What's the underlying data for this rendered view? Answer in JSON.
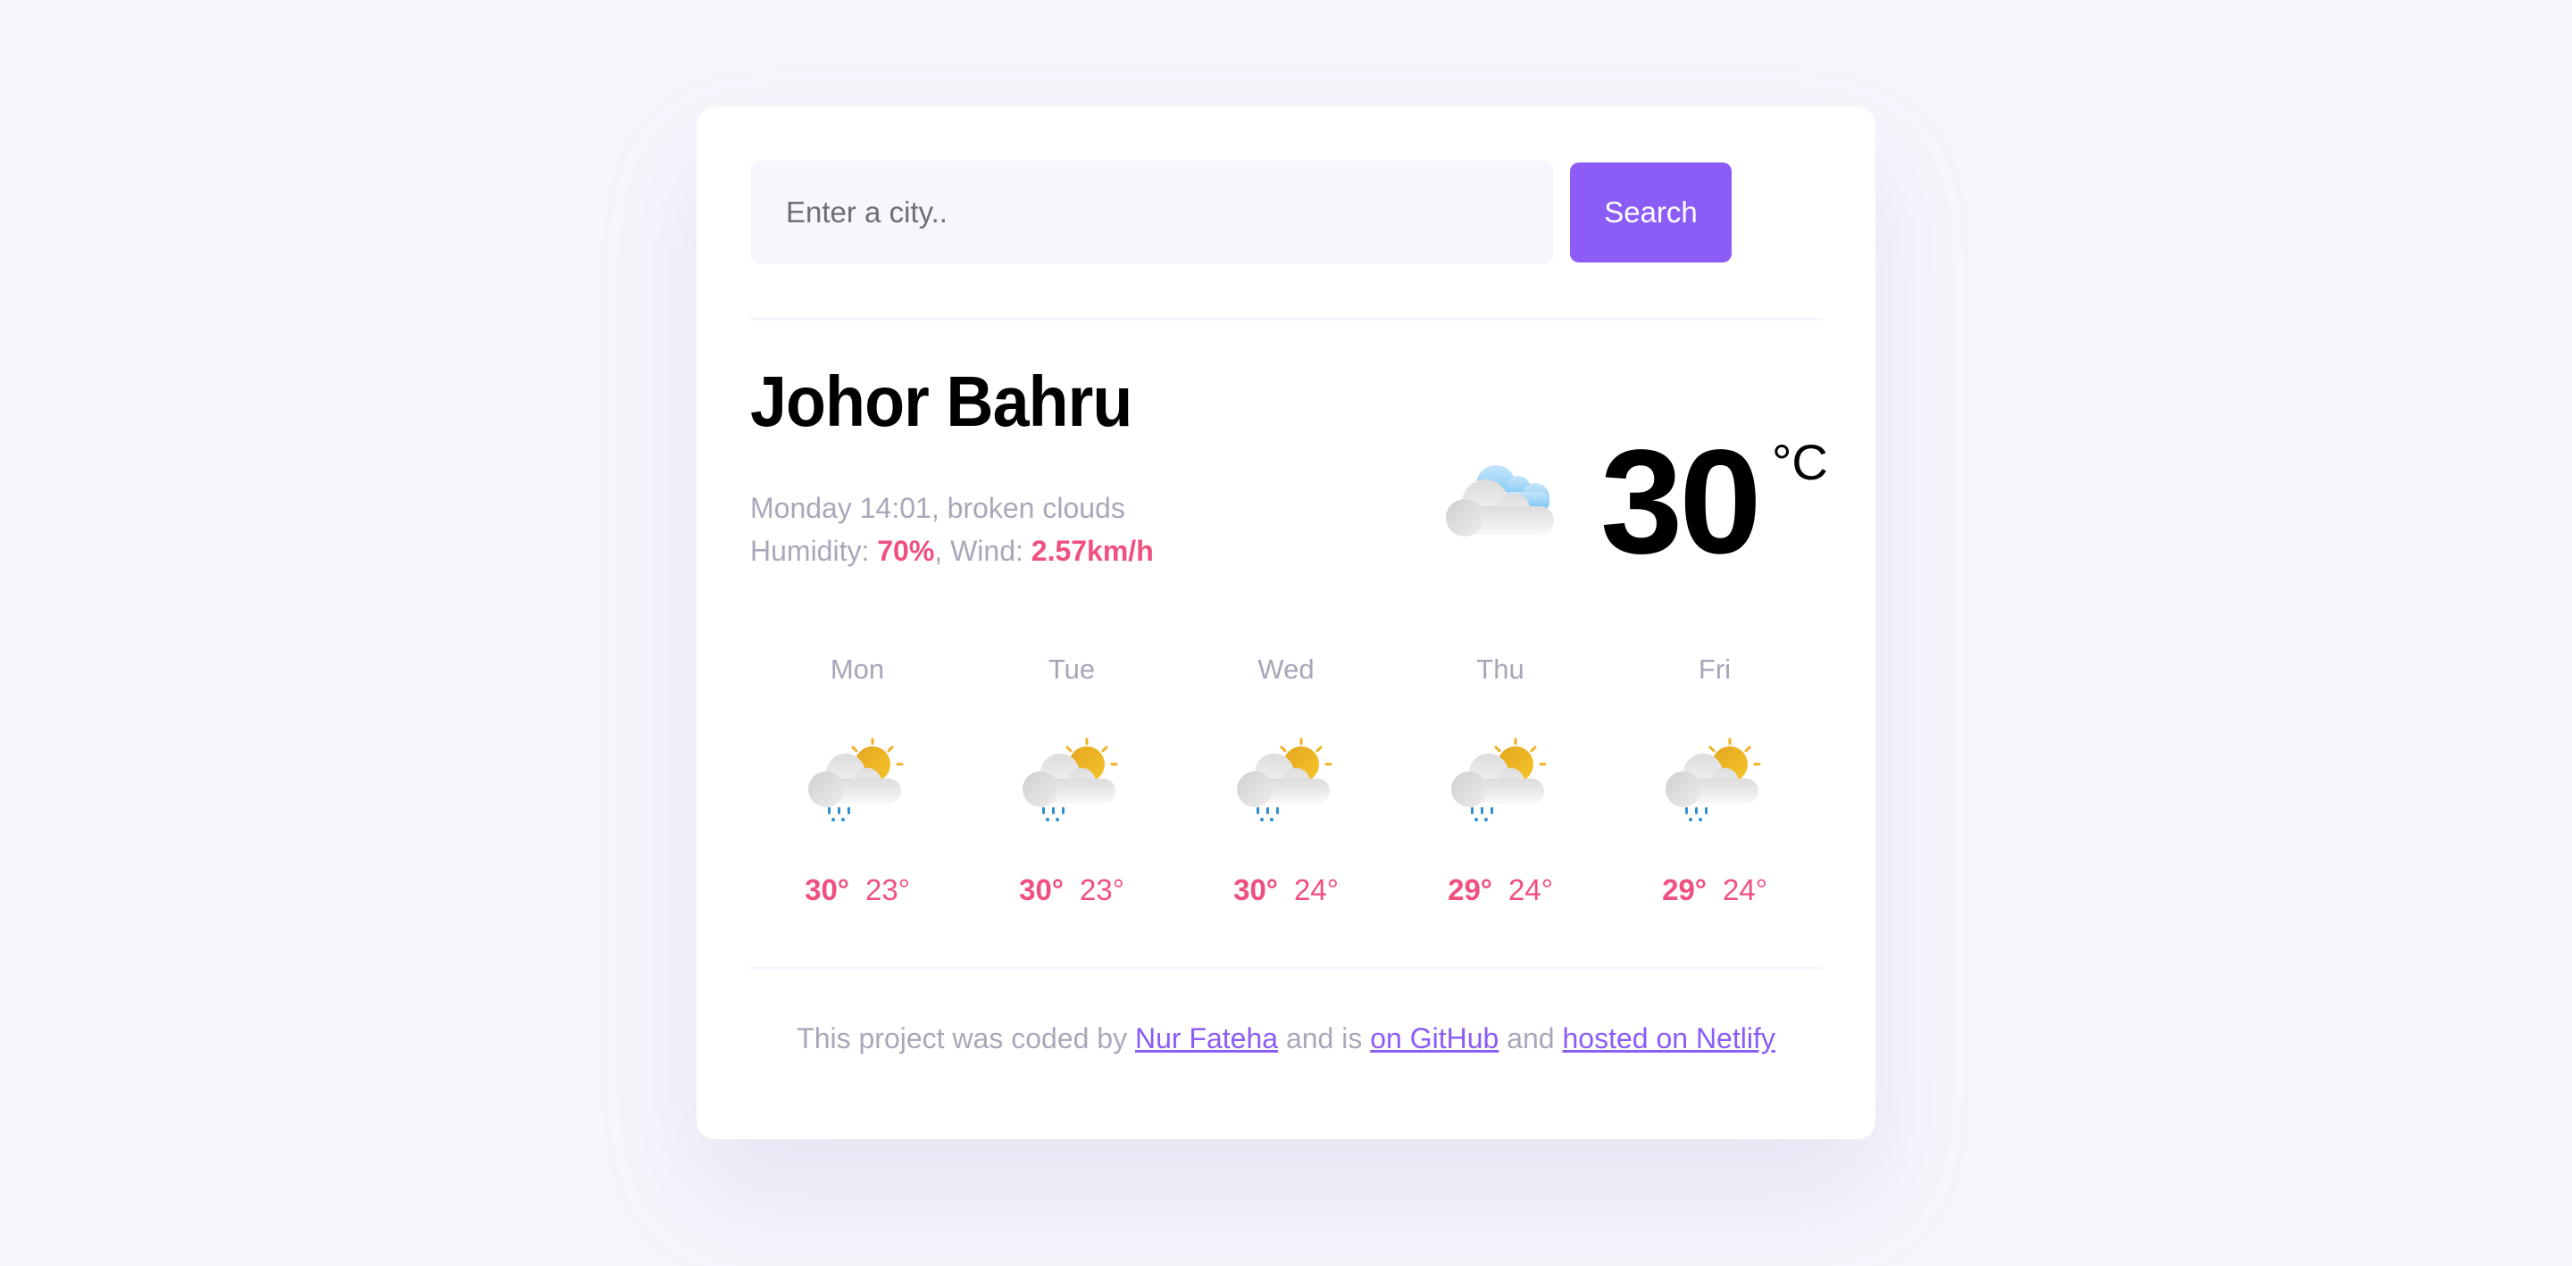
{
  "search": {
    "placeholder": "Enter a city..",
    "value": "",
    "button_label": "Search"
  },
  "current": {
    "city": "Johor Bahru",
    "day_time": "Monday 14:01",
    "description": "broken clouds",
    "humidity_label": "Humidity:",
    "humidity": "70%",
    "wind_label": "Wind:",
    "wind": "2.57km/h",
    "temperature": "30",
    "unit": "°C",
    "icon": "broken-clouds-icon"
  },
  "forecast": [
    {
      "day": "Mon",
      "max": "30°",
      "min": "23°",
      "icon": "rain-sun-icon"
    },
    {
      "day": "Tue",
      "max": "30°",
      "min": "23°",
      "icon": "rain-sun-icon"
    },
    {
      "day": "Wed",
      "max": "30°",
      "min": "24°",
      "icon": "rain-sun-icon"
    },
    {
      "day": "Thu",
      "max": "29°",
      "min": "24°",
      "icon": "rain-sun-icon"
    },
    {
      "day": "Fri",
      "max": "29°",
      "min": "24°",
      "icon": "rain-sun-icon"
    }
  ],
  "footer": {
    "text1": "This project was coded by ",
    "author_link": "Nur Fateha",
    "text2": " and is ",
    "github_link": "on GitHub",
    "text3": " and ",
    "netlify_link": "hosted on Netlify"
  },
  "colors": {
    "accent": "#8b5cf6",
    "highlight": "#f0507f",
    "muted": "#a9a7b9",
    "background": "#f7f5fc"
  }
}
